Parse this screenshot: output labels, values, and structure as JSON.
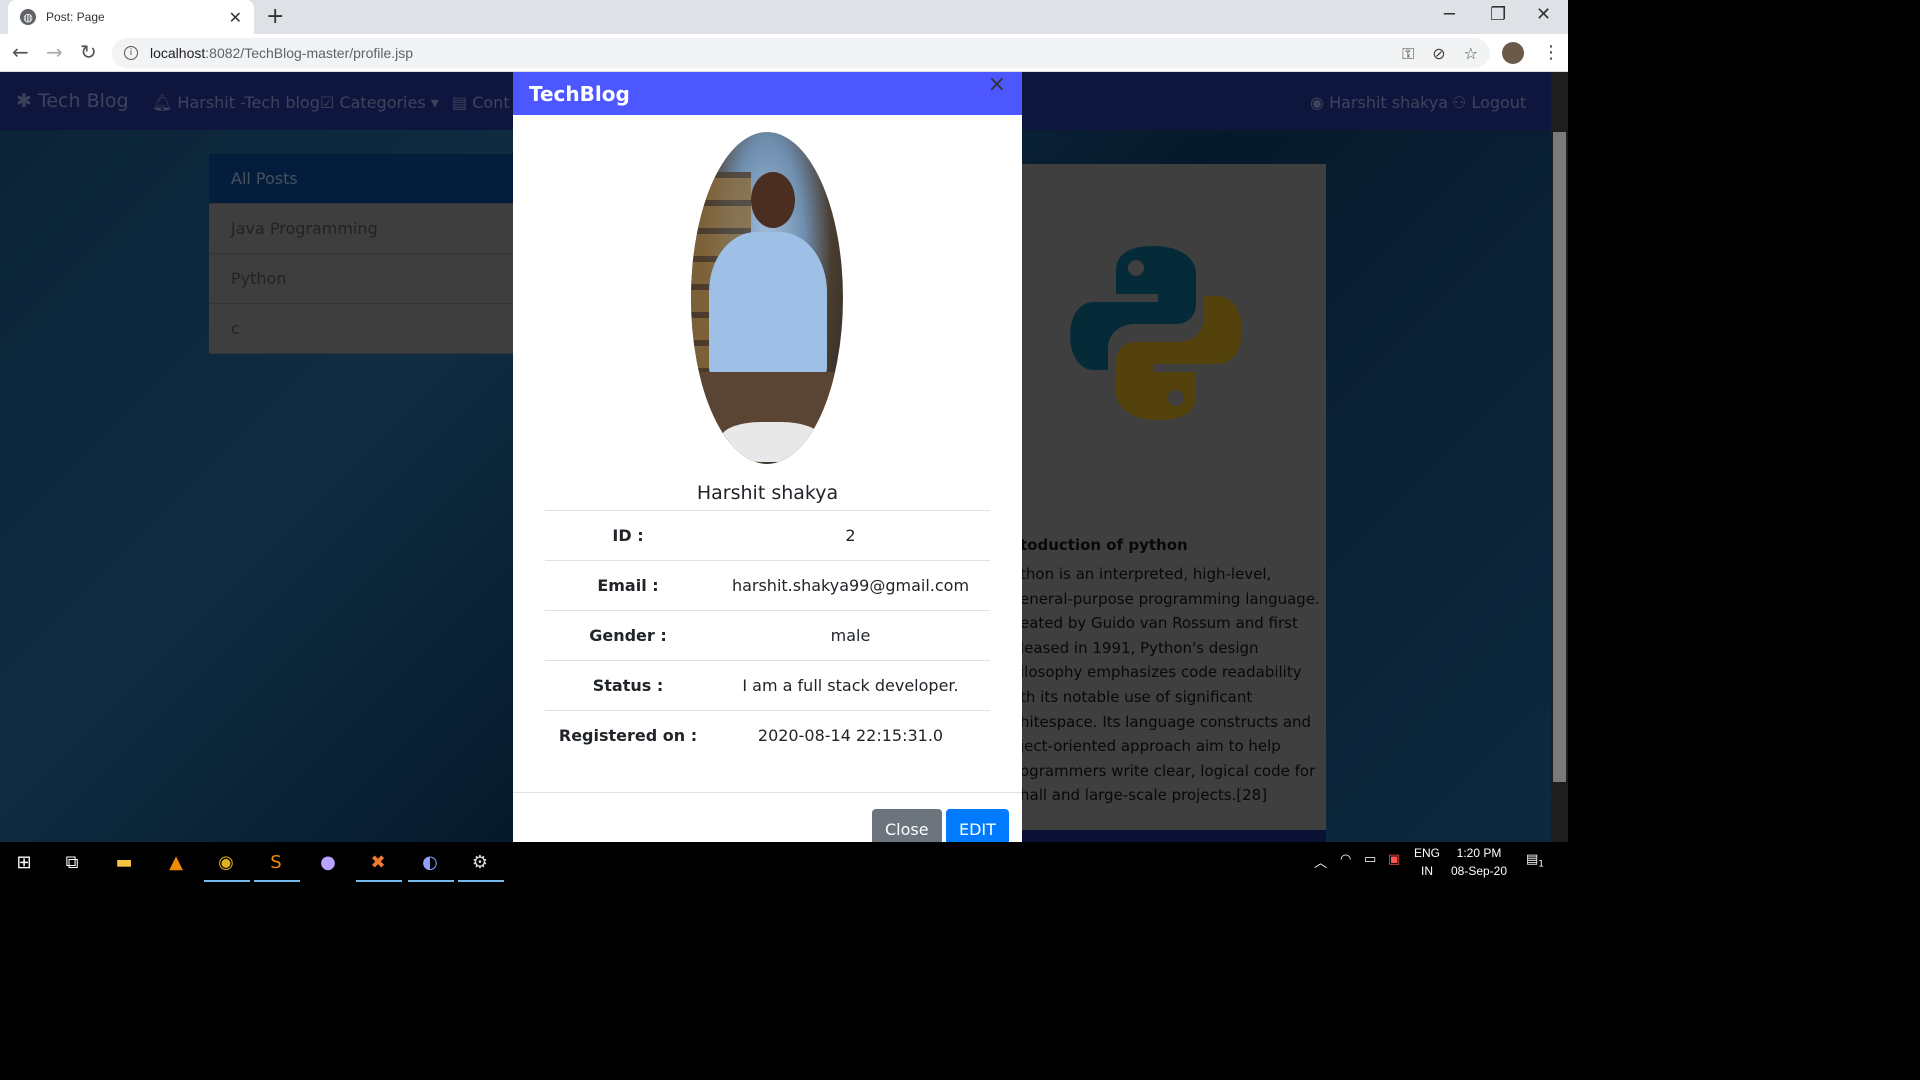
{
  "browser": {
    "tab_title": "Post: Page",
    "url_host": "localhost",
    "url_rest": ":8082/TechBlog-master/profile.jsp"
  },
  "site": {
    "brand": "Tech Blog",
    "nav": [
      {
        "label": "Harshit -Tech blog",
        "icon": "bell-icon"
      },
      {
        "label": "Categories",
        "icon": "check-square-icon"
      },
      {
        "label": "Cont",
        "icon": "id-card-icon"
      },
      {
        "label": "Harshit shakya",
        "icon": "user-circle-icon"
      },
      {
        "label": "Logout",
        "icon": "user-minus-icon"
      }
    ]
  },
  "categories": [
    "All Posts",
    "Java Programming",
    "Python",
    "c"
  ],
  "post": {
    "title": "toduction of python",
    "body": "thon is an interpreted, high-level, eneral-purpose programming language. eated by Guido van Rossum and first leased in 1991, Python's design ilosophy emphasizes code readability th its notable use of significant hitespace. Its language constructs and ject-oriented approach aim to help ogrammers write clear, logical code for hall and large-scale projects.[28]"
  },
  "modal": {
    "title": "TechBlog",
    "close_x": "×",
    "name": "Harshit shakya",
    "rows": [
      {
        "label": "ID :",
        "value": "2"
      },
      {
        "label": "Email :",
        "value": "harshit.shakya99@gmail.com"
      },
      {
        "label": "Gender :",
        "value": "male"
      },
      {
        "label": "Status :",
        "value": "I am a full stack developer."
      },
      {
        "label": "Registered on :",
        "value": "2020-08-14 22:15:31.0"
      }
    ],
    "close_button": "Close",
    "edit_button": "EDIT"
  },
  "taskbar": {
    "lang_1": "ENG",
    "lang_2": "IN",
    "time": "1:20 PM",
    "date": "08-Sep-20",
    "notification_count": "1"
  },
  "colors": {
    "modal_header": "#4c57ff",
    "edit_button": "#007bff",
    "close_button": "#6c757d",
    "navbar": "#1f2c7a"
  }
}
